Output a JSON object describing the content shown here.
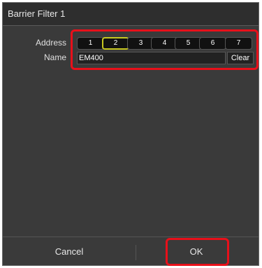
{
  "dialog": {
    "title": "Barrier Filter 1"
  },
  "address": {
    "label": "Address",
    "buttons": [
      "1",
      "2",
      "3",
      "4",
      "5",
      "6",
      "7"
    ],
    "selected": "2"
  },
  "name": {
    "label": "Name",
    "value": "EM400",
    "clear_label": "Clear"
  },
  "footer": {
    "cancel_label": "Cancel",
    "ok_label": "OK"
  },
  "colors": {
    "highlight": "#e8101a",
    "selected_border": "#c8c820",
    "background": "#3a3a3a"
  }
}
